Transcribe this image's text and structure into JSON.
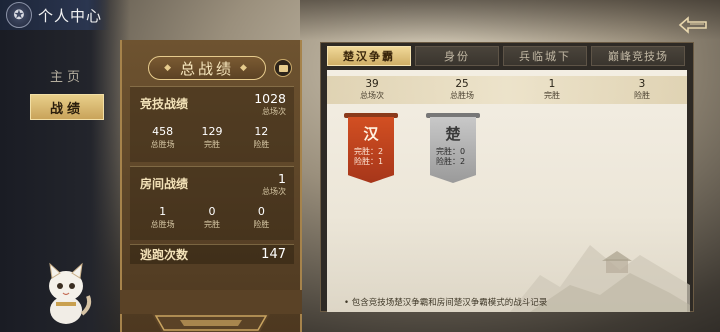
{
  "header": {
    "title": "个人中心",
    "logo_icon": "mask-emblem-icon",
    "back_icon": "back-arrow-icon"
  },
  "nav": {
    "items": [
      {
        "label": "主页",
        "active": false
      },
      {
        "label": "战绩",
        "active": true
      }
    ]
  },
  "summary": {
    "title": "总战绩",
    "competitive": {
      "label": "竞技战绩",
      "total": "1028",
      "total_unit": "总场次",
      "stats": [
        {
          "value": "458",
          "label": "总胜场"
        },
        {
          "value": "129",
          "label": "完胜"
        },
        {
          "value": "12",
          "label": "险胜"
        }
      ]
    },
    "room": {
      "label": "房间战绩",
      "total": "1",
      "total_unit": "总场次",
      "stats": [
        {
          "value": "1",
          "label": "总胜场"
        },
        {
          "value": "0",
          "label": "完胜"
        },
        {
          "value": "0",
          "label": "险胜"
        }
      ]
    },
    "escape": {
      "label": "逃跑次数",
      "value": "147"
    }
  },
  "tabs": [
    {
      "label": "楚汉争霸",
      "active": true
    },
    {
      "label": "身份",
      "active": false
    },
    {
      "label": "兵临城下",
      "active": false
    },
    {
      "label": "巅峰竞技场",
      "active": false
    }
  ],
  "mode_stats": [
    {
      "value": "39",
      "label": "总场次"
    },
    {
      "value": "25",
      "label": "总胜场"
    },
    {
      "value": "1",
      "label": "完胜"
    },
    {
      "value": "3",
      "label": "险胜"
    }
  ],
  "flags": [
    {
      "char": "汉",
      "line1": "完胜：2",
      "line2": "险胜：1",
      "color": "#c9441f"
    },
    {
      "char": "楚",
      "line1": "完胜：0",
      "line2": "险胜：2",
      "color": "#a8a8a8"
    }
  ],
  "footnote": "• 包含竞技场楚汉争霸和房间楚汉争霸模式的战斗记录"
}
